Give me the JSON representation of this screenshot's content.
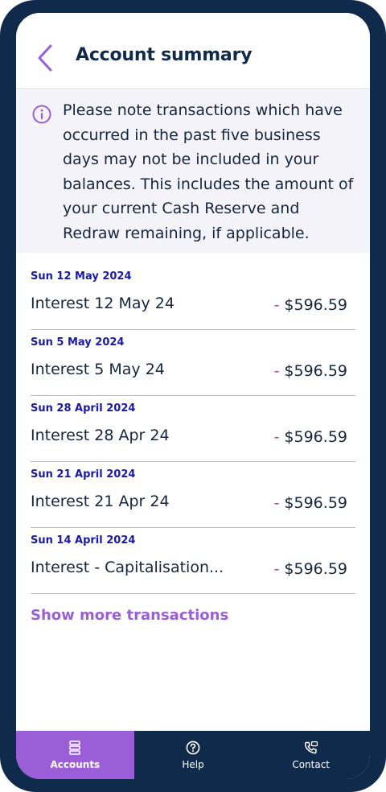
{
  "header": {
    "title": "Account summary"
  },
  "notice": {
    "text": "Please note transactions which have occurred in the past five business days may not be included in your balances. This includes the amount of your current Cash Reserve and Redraw remaining, if applicable."
  },
  "transactions": [
    {
      "date": "Sun 12 May 2024",
      "description": "Interest 12 May 24",
      "sign": "-",
      "amount": "$596.59"
    },
    {
      "date": "Sun 5 May 2024",
      "description": "Interest 5 May 24",
      "sign": "-",
      "amount": "$596.59"
    },
    {
      "date": "Sun 28 April 2024",
      "description": "Interest 28 Apr 24",
      "sign": "-",
      "amount": "$596.59"
    },
    {
      "date": "Sun 21 April 2024",
      "description": "Interest 21 Apr 24",
      "sign": "-",
      "amount": "$596.59"
    },
    {
      "date": "Sun 14 April 2024",
      "description": "Interest - Capitalisation...",
      "sign": "-",
      "amount": "$596.59"
    }
  ],
  "show_more_label": "Show more transactions",
  "tabs": [
    {
      "label": "Accounts",
      "icon": "accounts-icon",
      "active": true
    },
    {
      "label": "Help",
      "icon": "help-icon",
      "active": false
    },
    {
      "label": "Contact",
      "icon": "contact-icon",
      "active": false
    }
  ],
  "colors": {
    "navy": "#0f2a4a",
    "accent_purple": "#9a5fd6",
    "date_blue": "#1a1aa6",
    "negative_red": "#d6345a",
    "notice_bg": "#f4f3f9"
  }
}
